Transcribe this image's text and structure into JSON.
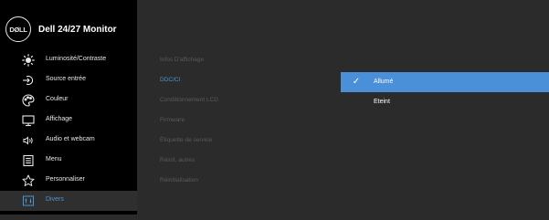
{
  "header": {
    "logo_text": "DØLL",
    "title": "Dell 24/27 Monitor"
  },
  "sidebar": {
    "items": [
      {
        "label": "Luminosité/Contraste",
        "icon": "brightness-icon"
      },
      {
        "label": "Source entrée",
        "icon": "input-source-icon"
      },
      {
        "label": "Couleur",
        "icon": "color-palette-icon"
      },
      {
        "label": "Affichage",
        "icon": "display-icon"
      },
      {
        "label": "Audio et webcam",
        "icon": "audio-icon"
      },
      {
        "label": "Menu",
        "icon": "menu-icon"
      },
      {
        "label": "Personnaliser",
        "icon": "star-icon"
      },
      {
        "label": "Divers",
        "icon": "others-icon",
        "active": true
      }
    ]
  },
  "submenu": {
    "items": [
      {
        "label": "Infos D'affichage"
      },
      {
        "label": "DDC/CI",
        "selected": true
      },
      {
        "label": "Conditionnement LCD"
      },
      {
        "label": "Firmware"
      },
      {
        "label": "Étiquette de service"
      },
      {
        "label": "Réinit. autres"
      },
      {
        "label": "Réinitialisation"
      }
    ]
  },
  "options": {
    "items": [
      {
        "label": "Allumé",
        "checked": true
      },
      {
        "label": "Eteint",
        "checked": false
      }
    ],
    "check_glyph": "✓"
  },
  "colors": {
    "background": "#2b2b2b",
    "sidebar": "#000000",
    "accent": "#4a90d9",
    "active_text": "#4a95d4"
  }
}
